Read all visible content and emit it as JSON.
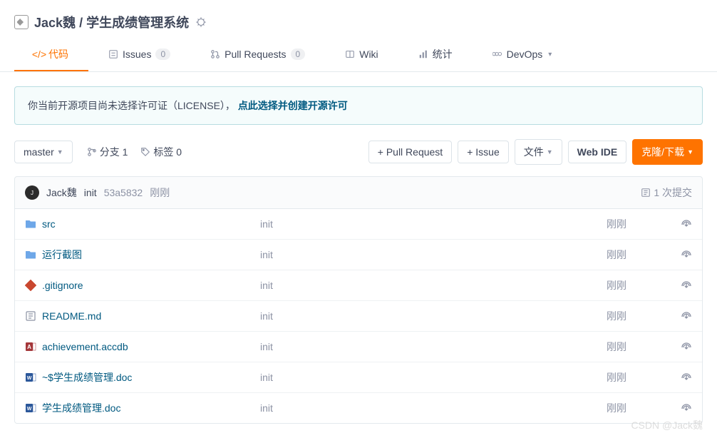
{
  "header": {
    "owner": "Jack魏",
    "separator": "/",
    "repo": "学生成绩管理系统"
  },
  "tabs": {
    "code": "代码",
    "issues": "Issues",
    "issues_count": "0",
    "pr": "Pull Requests",
    "pr_count": "0",
    "wiki": "Wiki",
    "stats": "统计",
    "devops": "DevOps"
  },
  "license_alert": {
    "text_before": "你当前开源项目尚未选择许可证（LICENSE）， ",
    "link": "点此选择并创建开源许可"
  },
  "toolbar": {
    "branch": "master",
    "branches_label": "分支 1",
    "tags_label": "标签 0",
    "pull_request": "+ Pull Request",
    "issue": "+ Issue",
    "files": "文件",
    "web_ide": "Web IDE",
    "clone": "克隆/下载"
  },
  "commit": {
    "author": "Jack魏",
    "message": "init",
    "hash": "53a5832",
    "time": "刚刚",
    "count": "1 次提交"
  },
  "files": [
    {
      "icon": "folder",
      "name": "src",
      "msg": "init",
      "time": "刚刚"
    },
    {
      "icon": "folder",
      "name": "运行截图",
      "msg": "init",
      "time": "刚刚"
    },
    {
      "icon": "git",
      "name": ".gitignore",
      "msg": "init",
      "time": "刚刚"
    },
    {
      "icon": "readme",
      "name": "README.md",
      "msg": "init",
      "time": "刚刚"
    },
    {
      "icon": "access",
      "name": "achievement.accdb",
      "msg": "init",
      "time": "刚刚"
    },
    {
      "icon": "word",
      "name": "~$学生成绩管理.doc",
      "msg": "init",
      "time": "刚刚"
    },
    {
      "icon": "word",
      "name": "学生成绩管理.doc",
      "msg": "init",
      "time": "刚刚"
    }
  ],
  "watermark": "CSDN @Jack魏"
}
